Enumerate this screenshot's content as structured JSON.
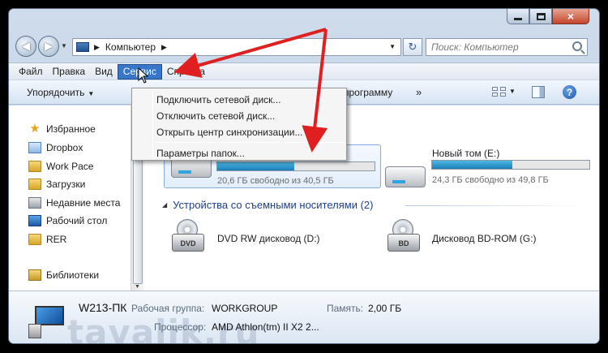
{
  "window": {
    "caption_buttons": {
      "minimize": "minimize",
      "maximize": "maximize",
      "close": "×"
    }
  },
  "nav": {
    "back_glyph": "◀",
    "forward_glyph": "▶",
    "history_caret": "▼",
    "address_path": "Компьютер",
    "address_sep": "▶",
    "address_dropdown": "▼",
    "refresh_glyph": "↻",
    "search_placeholder": "Поиск: Компьютер"
  },
  "menubar": {
    "items": [
      "Файл",
      "Правка",
      "Вид",
      "Сервис",
      "Справка"
    ],
    "active_index": 3
  },
  "toolbar": {
    "organize_label": "Упорядочить",
    "organize_caret": "▼",
    "program_label": "программу",
    "more_glyph": "»",
    "views_caret": "▼",
    "help_glyph": "?"
  },
  "sidebar": {
    "items": [
      {
        "label": "Избранное",
        "icon": "star-icon"
      },
      {
        "label": "Dropbox",
        "icon": "dropbox-icon"
      },
      {
        "label": "Work Pace",
        "icon": "folder-icon"
      },
      {
        "label": "Загрузки",
        "icon": "downloads-folder-icon"
      },
      {
        "label": "Недавние места",
        "icon": "recent-places-icon"
      },
      {
        "label": "Рабочий стол",
        "icon": "desktop-icon"
      },
      {
        "label": "RER",
        "icon": "folder-icon"
      },
      {
        "label": "Библиотеки",
        "icon": "libraries-icon"
      }
    ],
    "scroll_up": "▲",
    "scroll_down": "▼"
  },
  "drives": {
    "hard": [
      {
        "name": "",
        "free_text": "20,6 ГБ свободно из 40,5 ГБ",
        "used_fraction": 0.49
      },
      {
        "name": "Новый том (E:)",
        "free_text": "24,3 ГБ свободно из 49,8 ГБ",
        "used_fraction": 0.51
      }
    ],
    "removable_header": "Устройства со съемными носителями (2)",
    "removable_caret": "◢",
    "removable": [
      {
        "name": "DVD RW дисковод (D:)",
        "badge": "DVD"
      },
      {
        "name": "Дисковод BD-ROM (G:)",
        "badge": "BD"
      }
    ]
  },
  "details": {
    "computer_name": "W213-ПК",
    "workgroup_label": "Рабочая группа:",
    "workgroup_value": "WORKGROUP",
    "memory_label": "Память:",
    "memory_value": "2,00 ГБ",
    "cpu_label": "Процессор:",
    "cpu_value": "AMD Athlon(tm) II X2 2...",
    "watermark": "tavalik.ru"
  },
  "dropdown_menu": {
    "items": [
      "Подключить сетевой диск...",
      "Отключить сетевой диск...",
      "Открыть центр синхронизации...",
      "Параметры папок..."
    ]
  },
  "colors": {
    "annotation_arrow": "#e02020",
    "menu_highlight": "#3776c8",
    "group_header": "#1f3f8a"
  }
}
